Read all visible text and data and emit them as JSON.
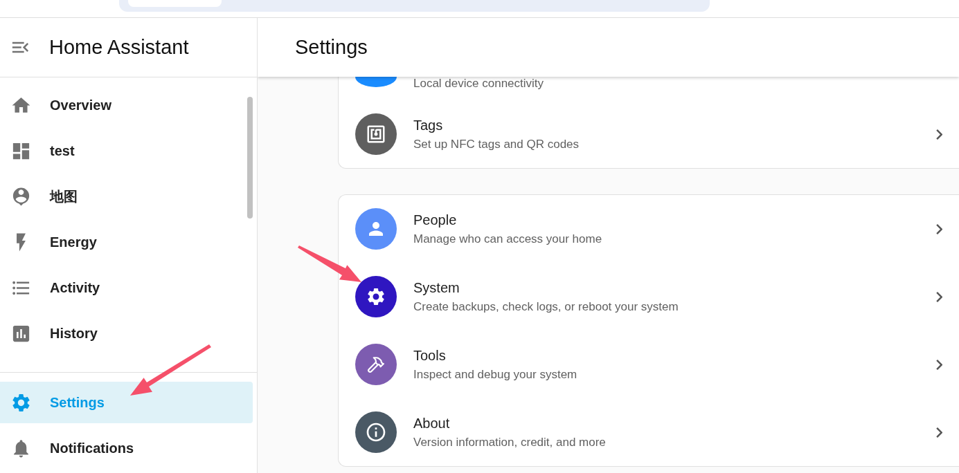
{
  "sidebar": {
    "title": "Home Assistant",
    "items": [
      {
        "label": "Overview",
        "selected": false
      },
      {
        "label": "test",
        "selected": false
      },
      {
        "label": "地图",
        "selected": false
      },
      {
        "label": "Energy",
        "selected": false
      },
      {
        "label": "Activity",
        "selected": false
      },
      {
        "label": "History",
        "selected": false
      }
    ],
    "bottom_items": [
      {
        "label": "Settings",
        "selected": true
      },
      {
        "label": "Notifications",
        "selected": false
      }
    ]
  },
  "header": {
    "title": "Settings"
  },
  "cards": [
    {
      "rows": [
        {
          "subtitle": "Local device connectivity",
          "color": "#1a8cff"
        },
        {
          "title": "Tags",
          "subtitle": "Set up NFC tags and QR codes",
          "color": "#5f5f5f"
        }
      ]
    },
    {
      "rows": [
        {
          "title": "People",
          "subtitle": "Manage who can access your home",
          "color": "#5b8ff9"
        },
        {
          "title": "System",
          "subtitle": "Create backups, check logs, or reboot your system",
          "color": "#2f16c0"
        },
        {
          "title": "Tools",
          "subtitle": "Inspect and debug your system",
          "color": "#7d5cb0"
        },
        {
          "title": "About",
          "subtitle": "Version information, credit, and more",
          "color": "#4a5965"
        }
      ]
    }
  ]
}
